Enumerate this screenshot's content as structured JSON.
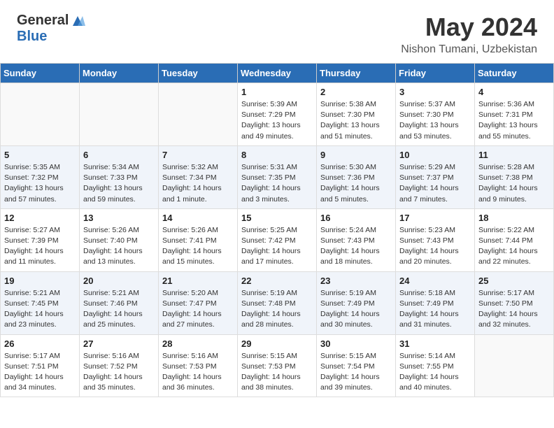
{
  "header": {
    "logo_general": "General",
    "logo_blue": "Blue",
    "month_year": "May 2024",
    "location": "Nishon Tumani, Uzbekistan"
  },
  "days_of_week": [
    "Sunday",
    "Monday",
    "Tuesday",
    "Wednesday",
    "Thursday",
    "Friday",
    "Saturday"
  ],
  "weeks": [
    [
      {
        "day": "",
        "info": ""
      },
      {
        "day": "",
        "info": ""
      },
      {
        "day": "",
        "info": ""
      },
      {
        "day": "1",
        "info": "Sunrise: 5:39 AM\nSunset: 7:29 PM\nDaylight: 13 hours\nand 49 minutes."
      },
      {
        "day": "2",
        "info": "Sunrise: 5:38 AM\nSunset: 7:30 PM\nDaylight: 13 hours\nand 51 minutes."
      },
      {
        "day": "3",
        "info": "Sunrise: 5:37 AM\nSunset: 7:30 PM\nDaylight: 13 hours\nand 53 minutes."
      },
      {
        "day": "4",
        "info": "Sunrise: 5:36 AM\nSunset: 7:31 PM\nDaylight: 13 hours\nand 55 minutes."
      }
    ],
    [
      {
        "day": "5",
        "info": "Sunrise: 5:35 AM\nSunset: 7:32 PM\nDaylight: 13 hours\nand 57 minutes."
      },
      {
        "day": "6",
        "info": "Sunrise: 5:34 AM\nSunset: 7:33 PM\nDaylight: 13 hours\nand 59 minutes."
      },
      {
        "day": "7",
        "info": "Sunrise: 5:32 AM\nSunset: 7:34 PM\nDaylight: 14 hours\nand 1 minute."
      },
      {
        "day": "8",
        "info": "Sunrise: 5:31 AM\nSunset: 7:35 PM\nDaylight: 14 hours\nand 3 minutes."
      },
      {
        "day": "9",
        "info": "Sunrise: 5:30 AM\nSunset: 7:36 PM\nDaylight: 14 hours\nand 5 minutes."
      },
      {
        "day": "10",
        "info": "Sunrise: 5:29 AM\nSunset: 7:37 PM\nDaylight: 14 hours\nand 7 minutes."
      },
      {
        "day": "11",
        "info": "Sunrise: 5:28 AM\nSunset: 7:38 PM\nDaylight: 14 hours\nand 9 minutes."
      }
    ],
    [
      {
        "day": "12",
        "info": "Sunrise: 5:27 AM\nSunset: 7:39 PM\nDaylight: 14 hours\nand 11 minutes."
      },
      {
        "day": "13",
        "info": "Sunrise: 5:26 AM\nSunset: 7:40 PM\nDaylight: 14 hours\nand 13 minutes."
      },
      {
        "day": "14",
        "info": "Sunrise: 5:26 AM\nSunset: 7:41 PM\nDaylight: 14 hours\nand 15 minutes."
      },
      {
        "day": "15",
        "info": "Sunrise: 5:25 AM\nSunset: 7:42 PM\nDaylight: 14 hours\nand 17 minutes."
      },
      {
        "day": "16",
        "info": "Sunrise: 5:24 AM\nSunset: 7:43 PM\nDaylight: 14 hours\nand 18 minutes."
      },
      {
        "day": "17",
        "info": "Sunrise: 5:23 AM\nSunset: 7:43 PM\nDaylight: 14 hours\nand 20 minutes."
      },
      {
        "day": "18",
        "info": "Sunrise: 5:22 AM\nSunset: 7:44 PM\nDaylight: 14 hours\nand 22 minutes."
      }
    ],
    [
      {
        "day": "19",
        "info": "Sunrise: 5:21 AM\nSunset: 7:45 PM\nDaylight: 14 hours\nand 23 minutes."
      },
      {
        "day": "20",
        "info": "Sunrise: 5:21 AM\nSunset: 7:46 PM\nDaylight: 14 hours\nand 25 minutes."
      },
      {
        "day": "21",
        "info": "Sunrise: 5:20 AM\nSunset: 7:47 PM\nDaylight: 14 hours\nand 27 minutes."
      },
      {
        "day": "22",
        "info": "Sunrise: 5:19 AM\nSunset: 7:48 PM\nDaylight: 14 hours\nand 28 minutes."
      },
      {
        "day": "23",
        "info": "Sunrise: 5:19 AM\nSunset: 7:49 PM\nDaylight: 14 hours\nand 30 minutes."
      },
      {
        "day": "24",
        "info": "Sunrise: 5:18 AM\nSunset: 7:49 PM\nDaylight: 14 hours\nand 31 minutes."
      },
      {
        "day": "25",
        "info": "Sunrise: 5:17 AM\nSunset: 7:50 PM\nDaylight: 14 hours\nand 32 minutes."
      }
    ],
    [
      {
        "day": "26",
        "info": "Sunrise: 5:17 AM\nSunset: 7:51 PM\nDaylight: 14 hours\nand 34 minutes."
      },
      {
        "day": "27",
        "info": "Sunrise: 5:16 AM\nSunset: 7:52 PM\nDaylight: 14 hours\nand 35 minutes."
      },
      {
        "day": "28",
        "info": "Sunrise: 5:16 AM\nSunset: 7:53 PM\nDaylight: 14 hours\nand 36 minutes."
      },
      {
        "day": "29",
        "info": "Sunrise: 5:15 AM\nSunset: 7:53 PM\nDaylight: 14 hours\nand 38 minutes."
      },
      {
        "day": "30",
        "info": "Sunrise: 5:15 AM\nSunset: 7:54 PM\nDaylight: 14 hours\nand 39 minutes."
      },
      {
        "day": "31",
        "info": "Sunrise: 5:14 AM\nSunset: 7:55 PM\nDaylight: 14 hours\nand 40 minutes."
      },
      {
        "day": "",
        "info": ""
      }
    ]
  ]
}
